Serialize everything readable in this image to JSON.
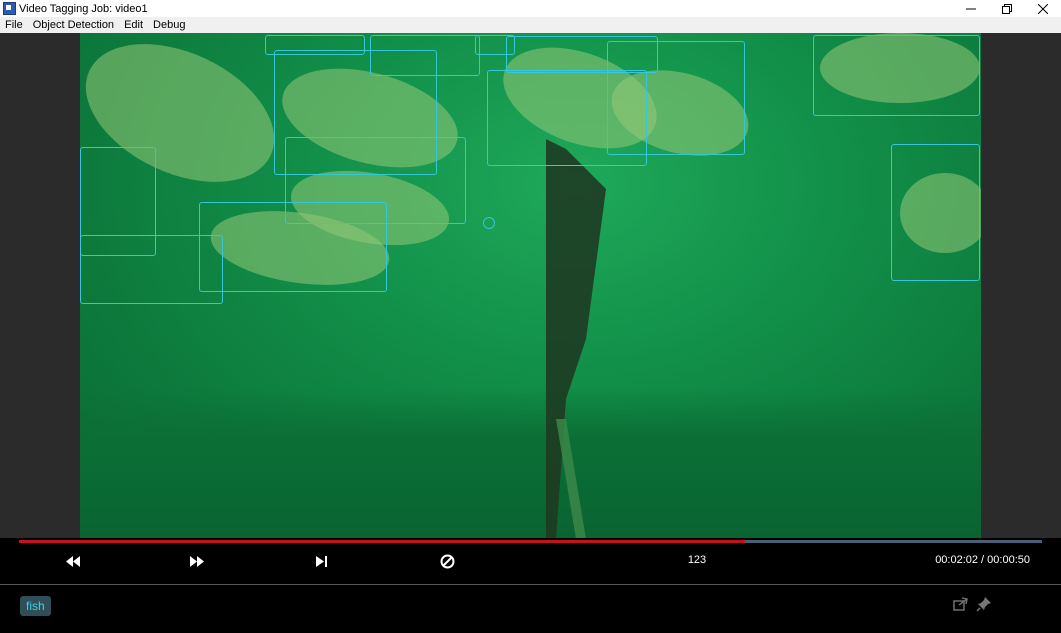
{
  "window": {
    "title": "Video Tagging Job: video1",
    "controls": [
      "minimize",
      "restore",
      "close"
    ]
  },
  "menu": [
    "File",
    "Object Detection",
    "Edit",
    "Debug"
  ],
  "video": {
    "bounding_box_color": "#35c6d8",
    "bounding_box_count": 13,
    "point_marker_count": 1
  },
  "playback": {
    "progress_fraction": 0.71,
    "progress_color": "#c2141a",
    "track_color": "#4a5e78",
    "frame": "123",
    "time": "00:02:02 / 00:00:50",
    "buttons": [
      "rewind-icon",
      "fast-forward-icon",
      "skip-to-end-icon",
      "clear-icon"
    ]
  },
  "tags": {
    "items": [
      "fish"
    ],
    "tag_color": "#3fd1e6",
    "actions": [
      "share-icon",
      "pin-icon"
    ]
  }
}
